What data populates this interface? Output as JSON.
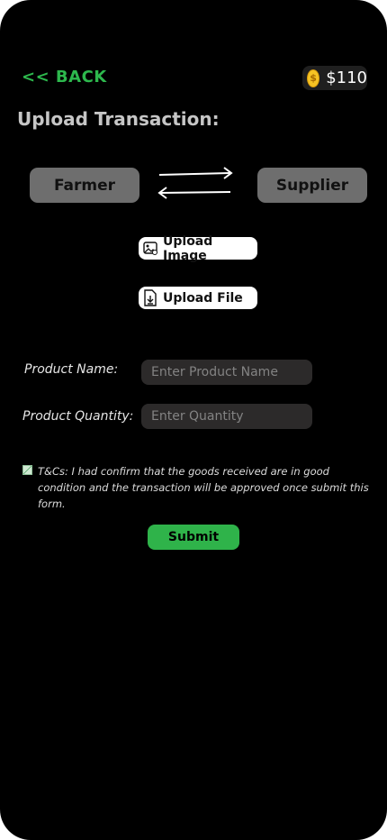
{
  "header": {
    "back_label": "<< BACK",
    "balance": "$110",
    "coin_icon": "coin-dollar-icon"
  },
  "page": {
    "title": "Upload Transaction:"
  },
  "roles": {
    "from": "Farmer",
    "to": "Supplier",
    "swap_icon": "swap-arrows-icon"
  },
  "uploads": {
    "image_label": "Upload Image",
    "image_icon": "image-icon",
    "file_label": "Upload File",
    "file_icon": "file-upload-icon"
  },
  "form": {
    "product_name_label": "Product Name:",
    "product_name_placeholder": "Enter Product Name",
    "product_name_value": "",
    "quantity_label": "Product Quantity:",
    "quantity_placeholder": "Enter Quantity",
    "quantity_value": ""
  },
  "terms": {
    "checked": true,
    "text": "T&Cs: I had confirm that the goods received are in good condition and the transaction will be approved once submit this form."
  },
  "actions": {
    "submit_label": "Submit"
  },
  "colors": {
    "accent_green": "#2db84d",
    "background": "#000000",
    "role_button": "#6e6e6e",
    "input_background": "#2c2a2a",
    "coin": "#f6c324"
  }
}
